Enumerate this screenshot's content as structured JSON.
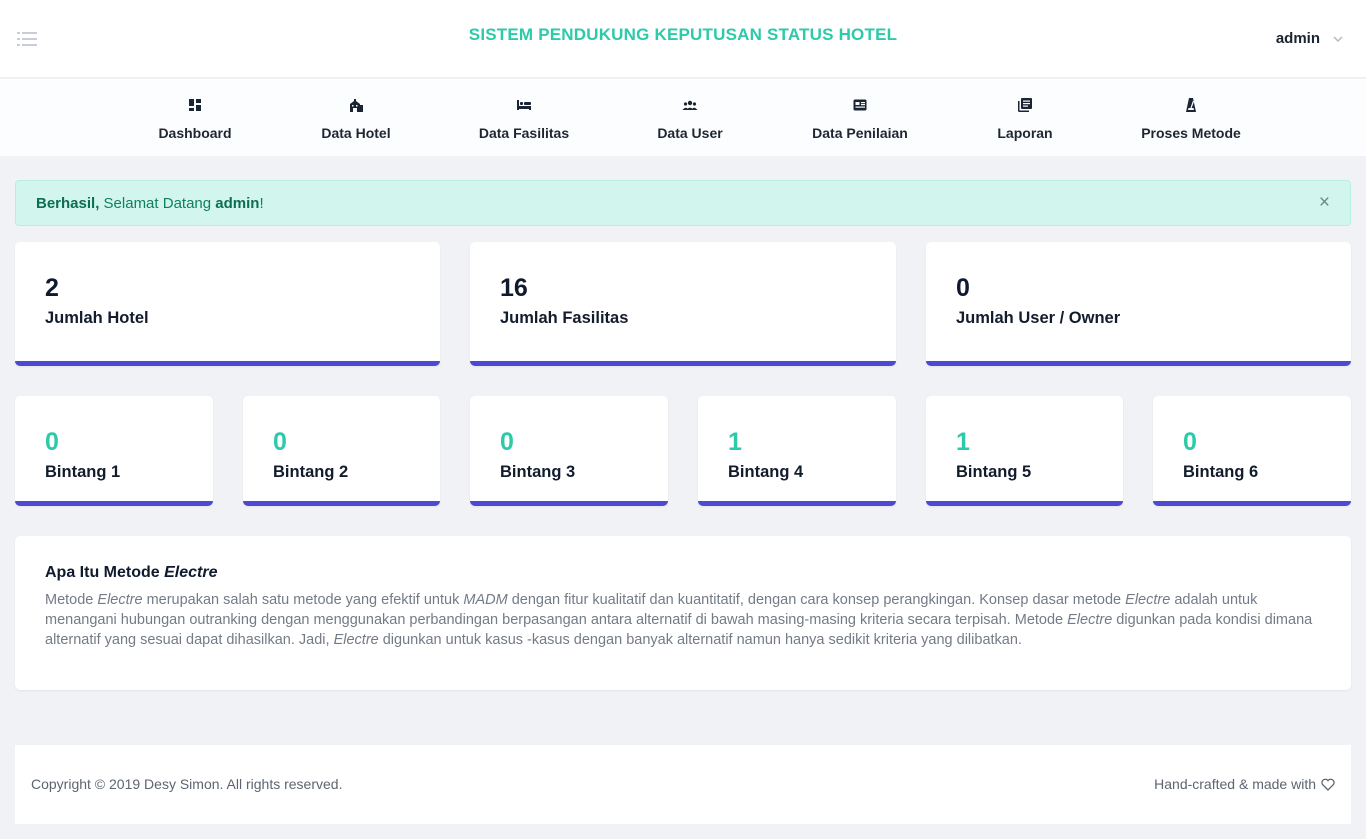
{
  "header": {
    "title": "SISTEM PENDUKUNG KEPUTUSAN STATUS HOTEL",
    "user_name": "admin",
    "menu_icon": "list-icon",
    "user_chevron_icon": "chevron-down-icon"
  },
  "nav": [
    {
      "label": "Dashboard",
      "icon": "dashboard-icon"
    },
    {
      "label": "Data Hotel",
      "icon": "building-icon"
    },
    {
      "label": "Data Fasilitas",
      "icon": "bed-icon"
    },
    {
      "label": "Data User",
      "icon": "users-icon"
    },
    {
      "label": "Data Penilaian",
      "icon": "card-icon"
    },
    {
      "label": "Laporan",
      "icon": "library-books-icon"
    },
    {
      "label": "Proses Metode",
      "icon": "metronome-icon"
    }
  ],
  "alert": {
    "strong": "Berhasil,",
    "text": " Selamat Datang ",
    "user": "admin",
    "end": "!",
    "close": "×"
  },
  "stats_main": [
    {
      "value": "2",
      "label": "Jumlah Hotel"
    },
    {
      "value": "16",
      "label": "Jumlah Fasilitas"
    },
    {
      "value": "0",
      "label": "Jumlah User / Owner"
    }
  ],
  "stats_bintang": [
    {
      "value": "0",
      "label": "Bintang 1"
    },
    {
      "value": "0",
      "label": "Bintang 2"
    },
    {
      "value": "0",
      "label": "Bintang 3"
    },
    {
      "value": "1",
      "label": "Bintang 4"
    },
    {
      "value": "1",
      "label": "Bintang 5"
    },
    {
      "value": "0",
      "label": "Bintang 6"
    }
  ],
  "info": {
    "title_prefix": "Apa Itu Metode ",
    "title_em": "Electre",
    "p": [
      "Metode ",
      "Electre",
      " merupakan salah satu metode yang efektif untuk ",
      "MADM",
      " dengan fitur kualitatif dan kuantitatif, dengan cara konsep perangkingan. Konsep dasar metode ",
      "Electre",
      " adalah untuk menangani hubungan outranking dengan menggunakan perbandingan berpasangan antara alternatif di bawah masing-masing kriteria secara terpisah. Metode ",
      "Electre",
      " digunkan pada kondisi dimana alternatif yang sesuai dapat dihasilkan. Jadi, ",
      "Electre",
      " digunkan untuk kasus -kasus dengan banyak alternatif namun hanya sedikit kriteria yang dilibatkan."
    ]
  },
  "footer": {
    "copyright": "Copyright © 2019 Desy Simon. All rights reserved.",
    "credit": "Hand-crafted & made with",
    "heart_icon": "heart-icon"
  },
  "colors": {
    "accent": "#2ccaa8",
    "card_border": "#4e49d3",
    "alert_bg": "#d2f6ee"
  }
}
